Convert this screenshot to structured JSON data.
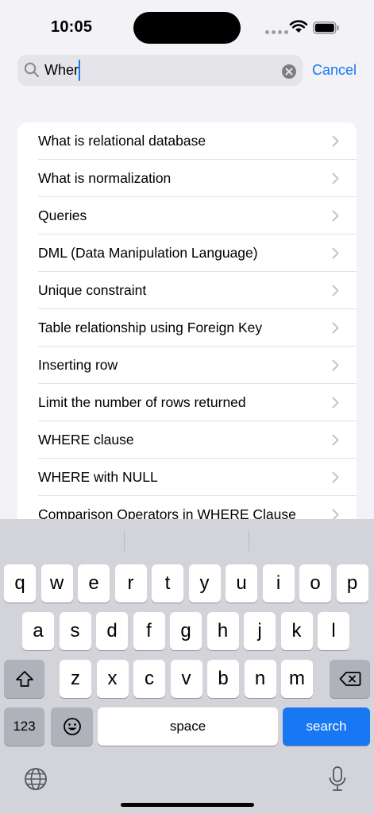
{
  "status": {
    "time": "10:05"
  },
  "search": {
    "value": "Wher",
    "cancel_label": "Cancel"
  },
  "results": [
    "What is relational database",
    "What is normalization",
    "Queries",
    "DML (Data Manipulation Language)",
    "Unique constraint",
    "Table relationship using Foreign Key",
    "Inserting row",
    "Limit the number of rows returned",
    "WHERE clause",
    "WHERE with NULL",
    "Comparison Operators in WHERE Clause"
  ],
  "keyboard": {
    "row1": [
      "q",
      "w",
      "e",
      "r",
      "t",
      "y",
      "u",
      "i",
      "o",
      "p"
    ],
    "row2": [
      "a",
      "s",
      "d",
      "f",
      "g",
      "h",
      "j",
      "k",
      "l"
    ],
    "row3": [
      "z",
      "x",
      "c",
      "v",
      "b",
      "n",
      "m"
    ],
    "numbers_label": "123",
    "space_label": "space",
    "search_label": "search"
  },
  "colors": {
    "accent": "#1877f2",
    "background": "#f2f2f7",
    "keyboard": "#d2d4da"
  }
}
